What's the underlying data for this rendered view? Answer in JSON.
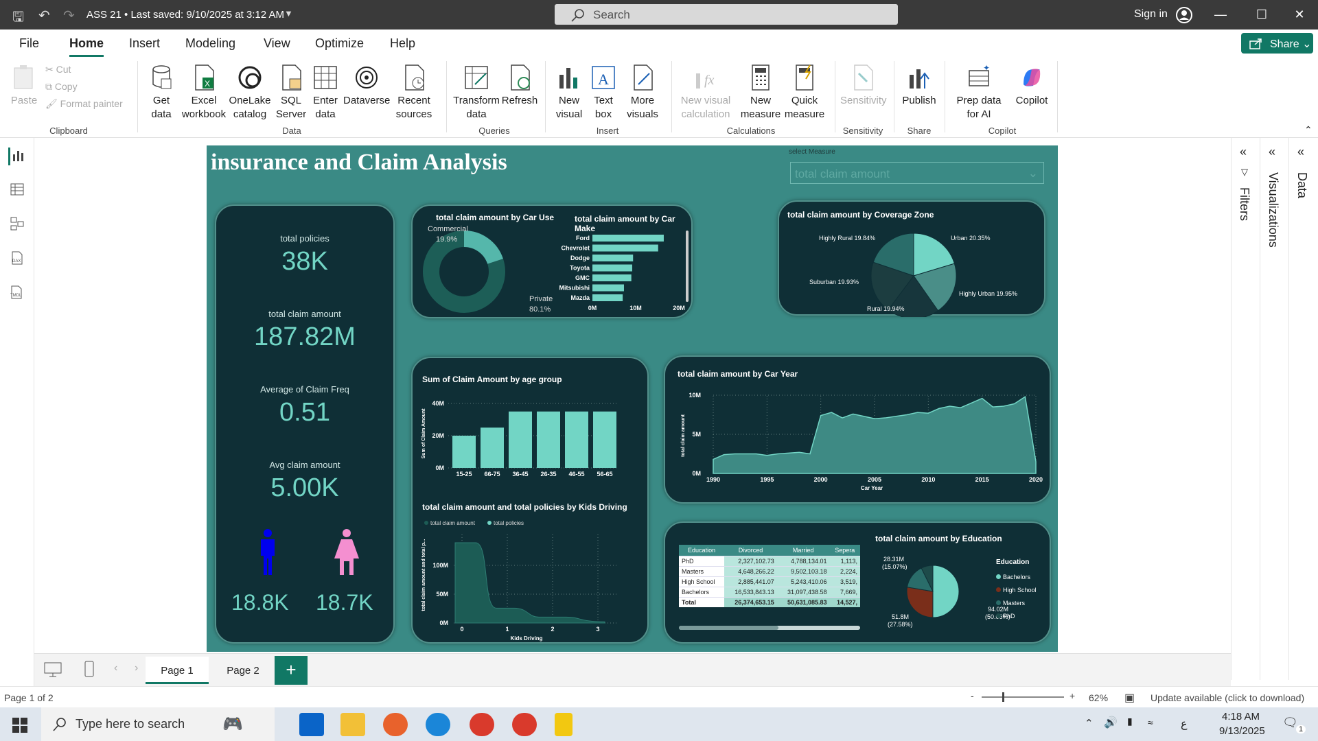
{
  "titlebar": {
    "doc_title": "ASS 21 • Last saved: 9/10/2025 at 3:12 AM",
    "search_placeholder": "Search",
    "signin": "Sign in"
  },
  "menu": [
    "File",
    "Home",
    "Insert",
    "Modeling",
    "View",
    "Optimize",
    "Help"
  ],
  "share_label": "Share",
  "ribbon": {
    "paste": "Paste",
    "cut": "Cut",
    "copy": "Copy",
    "format_painter": "Format painter",
    "get_data": "Get data",
    "excel_workbook": "Excel workbook",
    "onelake": "OneLake catalog",
    "sql_server": "SQL Server",
    "enter_data": "Enter data",
    "dataverse": "Dataverse",
    "recent_sources": "Recent sources",
    "transform_data": "Transform data",
    "refresh": "Refresh",
    "new_visual": "New visual",
    "text_box": "Text box",
    "more_visuals": "More visuals",
    "new_visual_calc": "New visual calculation",
    "new_measure": "New measure",
    "quick_measure": "Quick measure",
    "sensitivity": "Sensitivity",
    "publish": "Publish",
    "prep_ai": "Prep data for AI",
    "copilot": "Copilot",
    "groups": {
      "clipboard": "Clipboard",
      "data": "Data",
      "queries": "Queries",
      "insert": "Insert",
      "calculations": "Calculations",
      "sensitivity": "Sensitivity",
      "share": "Share",
      "copilot": "Copilot"
    }
  },
  "report": {
    "title": "insurance and Claim Analysis",
    "slicer_label": "select Measure",
    "slicer_value": "total claim amount",
    "kpis": [
      {
        "label": "total policies",
        "value": "38K"
      },
      {
        "label": "total claim amount",
        "value": "187.82M"
      },
      {
        "label": "Average of Claim Freq",
        "value": "0.51"
      },
      {
        "label": "Avg claim amount",
        "value": "5.00K"
      }
    ],
    "gender": {
      "male": "18.8K",
      "female": "18.7K",
      "male_color": "#0000ee",
      "female_color": "#f48fd0"
    },
    "car_use": {
      "title": "total claim amount by Car Use",
      "commercial_label": "Commercial",
      "commercial_pct": "19.9%",
      "private_label": "Private",
      "private_pct": "80.1%"
    },
    "car_make": {
      "title": "total claim amount by Car Make",
      "ticks": [
        "0M",
        "10M",
        "20M"
      ]
    },
    "coverage": {
      "title": "total claim amount by Coverage Zone",
      "labels": [
        "Highly Rural 19.84%",
        "Urban 20.35%",
        "Suburban 19.93%",
        "Highly Urban 19.95%",
        "Rural 19.94%"
      ]
    },
    "age": {
      "title": "Sum of Claim Amount by age group",
      "ylabel": "Sum of Claim Amount",
      "yticks": [
        "40M",
        "20M",
        "0M"
      ]
    },
    "car_year": {
      "title": "total claim amount by Car Year",
      "ylabel": "total claim amount",
      "xlabel": "Car Year",
      "yticks": [
        "10M",
        "5M",
        "0M"
      ],
      "xticks": [
        "1990",
        "1995",
        "2000",
        "2005",
        "2010",
        "2015",
        "2020"
      ]
    },
    "kids": {
      "title": "total claim amount and total policies by Kids Driving",
      "legend": [
        "total claim amount",
        "total policies"
      ],
      "ylabel": "total claim amount and total p...",
      "xlabel": "Kids Driving",
      "yticks": [
        "100M",
        "50M",
        "0M"
      ],
      "xticks": [
        "0",
        "1",
        "2",
        "3"
      ]
    },
    "edu_table": {
      "headers": [
        "Education",
        "Divorced",
        "Married",
        "Sepera"
      ],
      "rows": [
        [
          "PhD",
          "2,327,102.73",
          "4,788,134.01",
          "1,113,"
        ],
        [
          "Masters",
          "4,648,266.22",
          "9,502,103.18",
          "2,224,"
        ],
        [
          "High School",
          "2,885,441.07",
          "5,243,410.06",
          "3,519,"
        ],
        [
          "Bachelors",
          "16,533,843.13",
          "31,097,438.58",
          "7,669,"
        ],
        [
          "Total",
          "26,374,653.15",
          "50,631,085.83",
          "14,527,"
        ]
      ]
    },
    "edu_pie": {
      "title": "total claim amount by Education",
      "label_top": "28.31M",
      "label_top_pct": "(15.07%)",
      "label_left": "51.8M",
      "label_left_pct": "(27.58%)",
      "label_right": "94.02M",
      "label_right_pct": "(50.06%)",
      "legend_title": "Education",
      "legend": [
        "Bachelors",
        "High School",
        "Masters",
        "PhD"
      ]
    }
  },
  "chart_data": [
    {
      "type": "pie",
      "title": "total claim amount by Car Use",
      "categories": [
        "Commercial",
        "Private"
      ],
      "values": [
        19.9,
        80.1
      ]
    },
    {
      "type": "bar",
      "title": "total claim amount by Car Make",
      "categories": [
        "Ford",
        "Chevrolet",
        "Dodge",
        "Toyota",
        "GMC",
        "Mitsubishi",
        "Mazda"
      ],
      "values": [
        16.5,
        15.2,
        9.4,
        9.2,
        9.0,
        7.3,
        7.0
      ],
      "xlim": [
        0,
        20
      ]
    },
    {
      "type": "pie",
      "title": "total claim amount by Coverage Zone",
      "categories": [
        "Urban",
        "Highly Urban",
        "Rural",
        "Suburban",
        "Highly Rural"
      ],
      "values": [
        20.35,
        19.95,
        19.94,
        19.93,
        19.84
      ]
    },
    {
      "type": "bar",
      "title": "Sum of Claim Amount by age group",
      "categories": [
        "15-25",
        "66-75",
        "36-45",
        "26-35",
        "46-55",
        "56-65"
      ],
      "values": [
        20,
        25,
        35,
        35,
        35,
        35
      ],
      "ylim": [
        0,
        40
      ]
    },
    {
      "type": "area",
      "title": "total claim amount by Car Year",
      "x": [
        1990,
        1991,
        1992,
        1993,
        1994,
        1995,
        1996,
        1997,
        1998,
        1999,
        2000,
        2001,
        2002,
        2003,
        2004,
        2005,
        2006,
        2007,
        2008,
        2009,
        2010,
        2011,
        2012,
        2013,
        2014,
        2015,
        2016,
        2017,
        2018,
        2019,
        2020
      ],
      "values": [
        1.8,
        2.4,
        2.5,
        2.5,
        2.5,
        2.3,
        2.5,
        2.6,
        2.7,
        2.5,
        7.4,
        7.8,
        7.1,
        7.6,
        7.3,
        7.0,
        7.1,
        7.3,
        7.5,
        7.8,
        7.7,
        8.3,
        8.6,
        8.4,
        9.0,
        9.6,
        8.5,
        8.6,
        8.9,
        9.8,
        1.5
      ],
      "ylim": [
        0,
        10
      ]
    },
    {
      "type": "area",
      "title": "total claim amount and total policies by Kids Driving",
      "x": [
        0,
        1,
        2,
        3
      ],
      "values": [
        135,
        25,
        10,
        2
      ],
      "ylim": [
        0,
        150
      ]
    },
    {
      "type": "pie",
      "title": "total claim amount by Education",
      "categories": [
        "Bachelors",
        "High School",
        "Masters",
        "PhD"
      ],
      "values": [
        94.02,
        51.8,
        28.31,
        13.69
      ]
    }
  ],
  "panes": {
    "filters": "Filters",
    "visualizations": "Visualizations",
    "data": "Data"
  },
  "pages": [
    "Page 1",
    "Page 2"
  ],
  "status": {
    "page_of": "Page 1 of 2",
    "zoom": "62%",
    "update": "Update available (click to download)"
  },
  "taskbar": {
    "search_placeholder": "Type here to search",
    "time": "4:18 AM",
    "date": "9/13/2025",
    "lang": "ع",
    "notif_count": "1"
  }
}
